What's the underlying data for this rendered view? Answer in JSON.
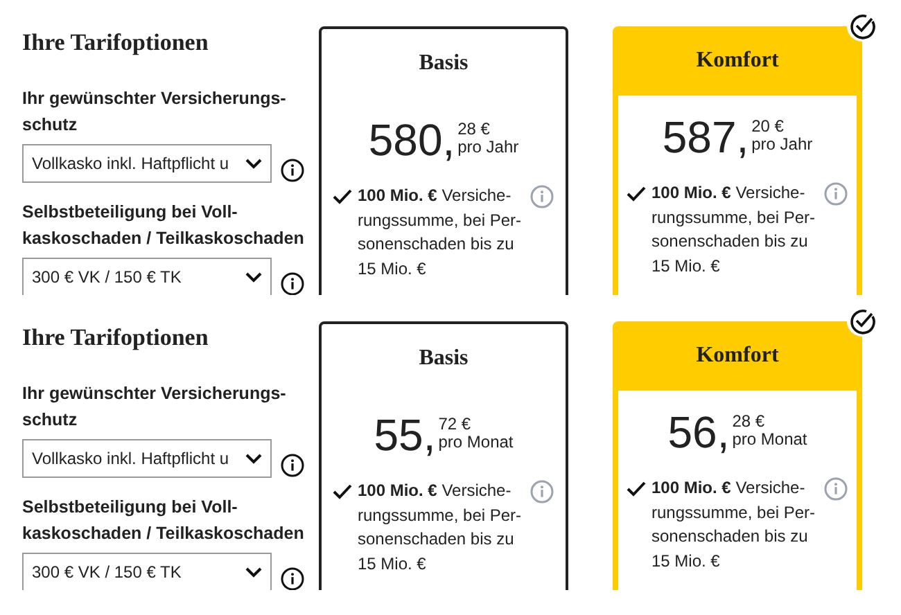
{
  "panels": [
    {
      "title": "Ihre Tarifoptionen",
      "options": [
        {
          "label_lines": [
            "Ihr gewünschter Versicherungs-",
            "schutz"
          ],
          "value": "Vollkasko inkl. Haftpflicht u"
        },
        {
          "label_lines": [
            "Selbstbeteiligung bei Voll-",
            "kaskoschaden / Teilkaskoschaden"
          ],
          "value": "300 € VK / 150 € TK"
        }
      ],
      "plans": [
        {
          "name": "Basis",
          "selected": false,
          "price_main": "580,",
          "price_cents": "28 €",
          "period": "pro Jahr",
          "features": [
            {
              "lines": [
                "**100 Mio. €** Versiche-",
                "rungssumme, bei Per-",
                "sonenschaden bis zu",
                "15 Mio. €"
              ]
            }
          ]
        },
        {
          "name": "Komfort",
          "selected": true,
          "price_main": "587,",
          "price_cents": "20 €",
          "period": "pro Jahr",
          "features": [
            {
              "lines": [
                "**100 Mio. €** Versiche-",
                "rungssumme, bei Per-",
                "sonenschaden bis zu",
                "15 Mio. €"
              ]
            }
          ]
        }
      ]
    },
    {
      "title": "Ihre Tarifoptionen",
      "options": [
        {
          "label_lines": [
            "Ihr gewünschter Versicherungs-",
            "schutz"
          ],
          "value": "Vollkasko inkl. Haftpflicht u"
        },
        {
          "label_lines": [
            "Selbstbeteiligung bei Voll-",
            "kaskoschaden / Teilkaskoschaden"
          ],
          "value": "300 € VK / 150 € TK"
        }
      ],
      "plans": [
        {
          "name": "Basis",
          "selected": false,
          "price_main": "55,",
          "price_cents": "72 €",
          "period": "pro Monat",
          "features": [
            {
              "lines": [
                "**100 Mio. €** Versiche-",
                "rungssumme, bei Per-",
                "sonenschaden bis zu",
                "15 Mio. €"
              ]
            }
          ]
        },
        {
          "name": "Komfort",
          "selected": true,
          "price_main": "56,",
          "price_cents": "28 €",
          "period": "pro Monat",
          "features": [
            {
              "lines": [
                "**100 Mio. €** Versiche-",
                "rungssumme, bei Per-",
                "sonenschaden bis zu",
                "15 Mio. €"
              ]
            }
          ]
        }
      ]
    }
  ]
}
